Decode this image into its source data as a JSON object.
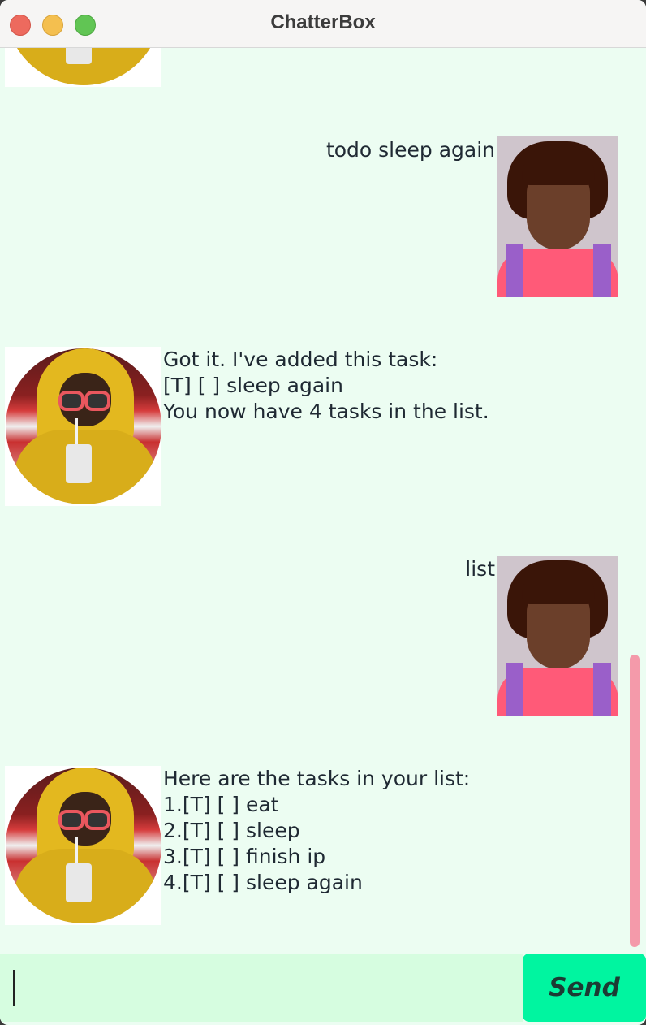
{
  "window": {
    "title": "ChatterBox"
  },
  "messages": [
    {
      "sender": "bot",
      "lines": []
    },
    {
      "sender": "user",
      "text": "todo sleep again"
    },
    {
      "sender": "bot",
      "text": "Got it. I've added this task:\n[T] [ ] sleep again\nYou now have 4 tasks in the list."
    },
    {
      "sender": "user",
      "text": "list"
    },
    {
      "sender": "bot",
      "text": "Here are the tasks in your list:\n1.[T] [ ] eat\n2.[T] [ ] sleep\n3.[T] [ ] finish ip\n4.[T] [ ] sleep again"
    }
  ],
  "input": {
    "value": "",
    "placeholder": ""
  },
  "send_button": {
    "label": "Send"
  },
  "colors": {
    "chat_background": "#ecfdf2",
    "input_background": "#d6fde0",
    "send_button": "#00f5a0",
    "scrollbar": "#f49aaa"
  },
  "icons": {
    "bot_avatar": "bot-avatar-icon",
    "user_avatar": "user-avatar-icon"
  }
}
